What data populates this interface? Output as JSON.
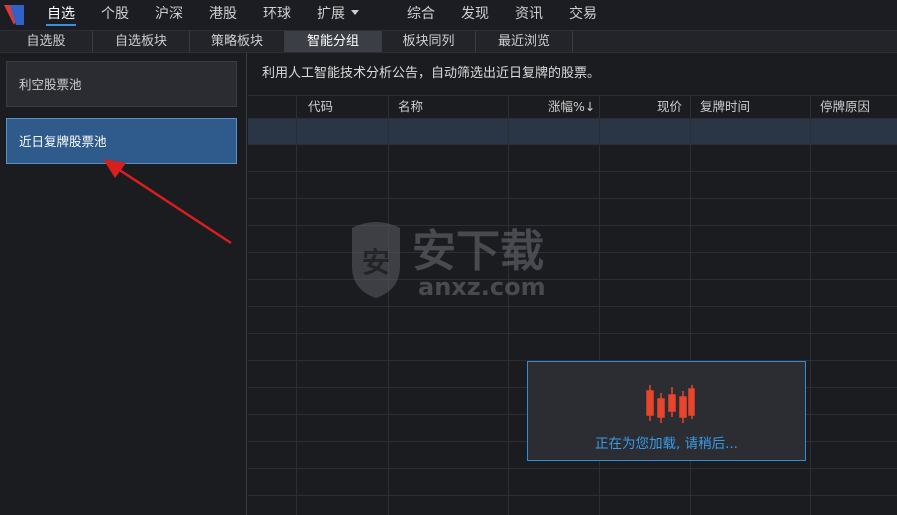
{
  "topnav": {
    "items": [
      "自选",
      "个股",
      "沪深",
      "港股",
      "环球",
      "扩展",
      "综合",
      "发现",
      "资讯",
      "交易"
    ],
    "active": "自选"
  },
  "subtabs": {
    "items": [
      "自选股",
      "自选板块",
      "策略板块",
      "智能分组",
      "板块同列",
      "最近浏览"
    ],
    "active": "智能分组"
  },
  "pools": [
    "利空股票池",
    "近日复牌股票池"
  ],
  "selected_pool": "近日复牌股票池",
  "description": "利用人工智能技术分析公告，自动筛选出近日复牌的股票。",
  "table": {
    "columns": [
      "代码",
      "名称",
      "涨幅%↓",
      "现价",
      "复牌时间",
      "停牌原因"
    ],
    "rows": []
  },
  "watermark": {
    "title": "安下载",
    "subtitle": "anxz.com",
    "badge": "安"
  },
  "loading": {
    "message": "正在为您加载, 请稍后..."
  },
  "colors": {
    "accent": "#3b8fe0",
    "selected_pool_bg": "#2f5a8c",
    "loading_text": "#3a9be6",
    "candles": "#e8452c",
    "arrow": "#d81e1e"
  },
  "icons": [
    "app-logo-icon",
    "chevron-down-icon",
    "candlestick-loading-icon",
    "shield-watermark-icon",
    "annotation-arrow"
  ]
}
